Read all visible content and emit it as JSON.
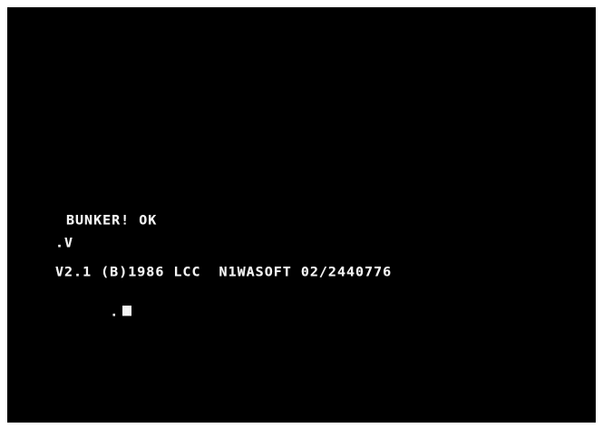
{
  "terminal": {
    "lines": [
      "BUNKER! OK",
      ".V",
      "V2.1 (B)1986 LCC  N1WASOFT 02/2440776"
    ],
    "prompt": "."
  },
  "colors": {
    "screen_background": "#000000",
    "text": "#f4f4f4",
    "outer_border": "#ffffff"
  }
}
